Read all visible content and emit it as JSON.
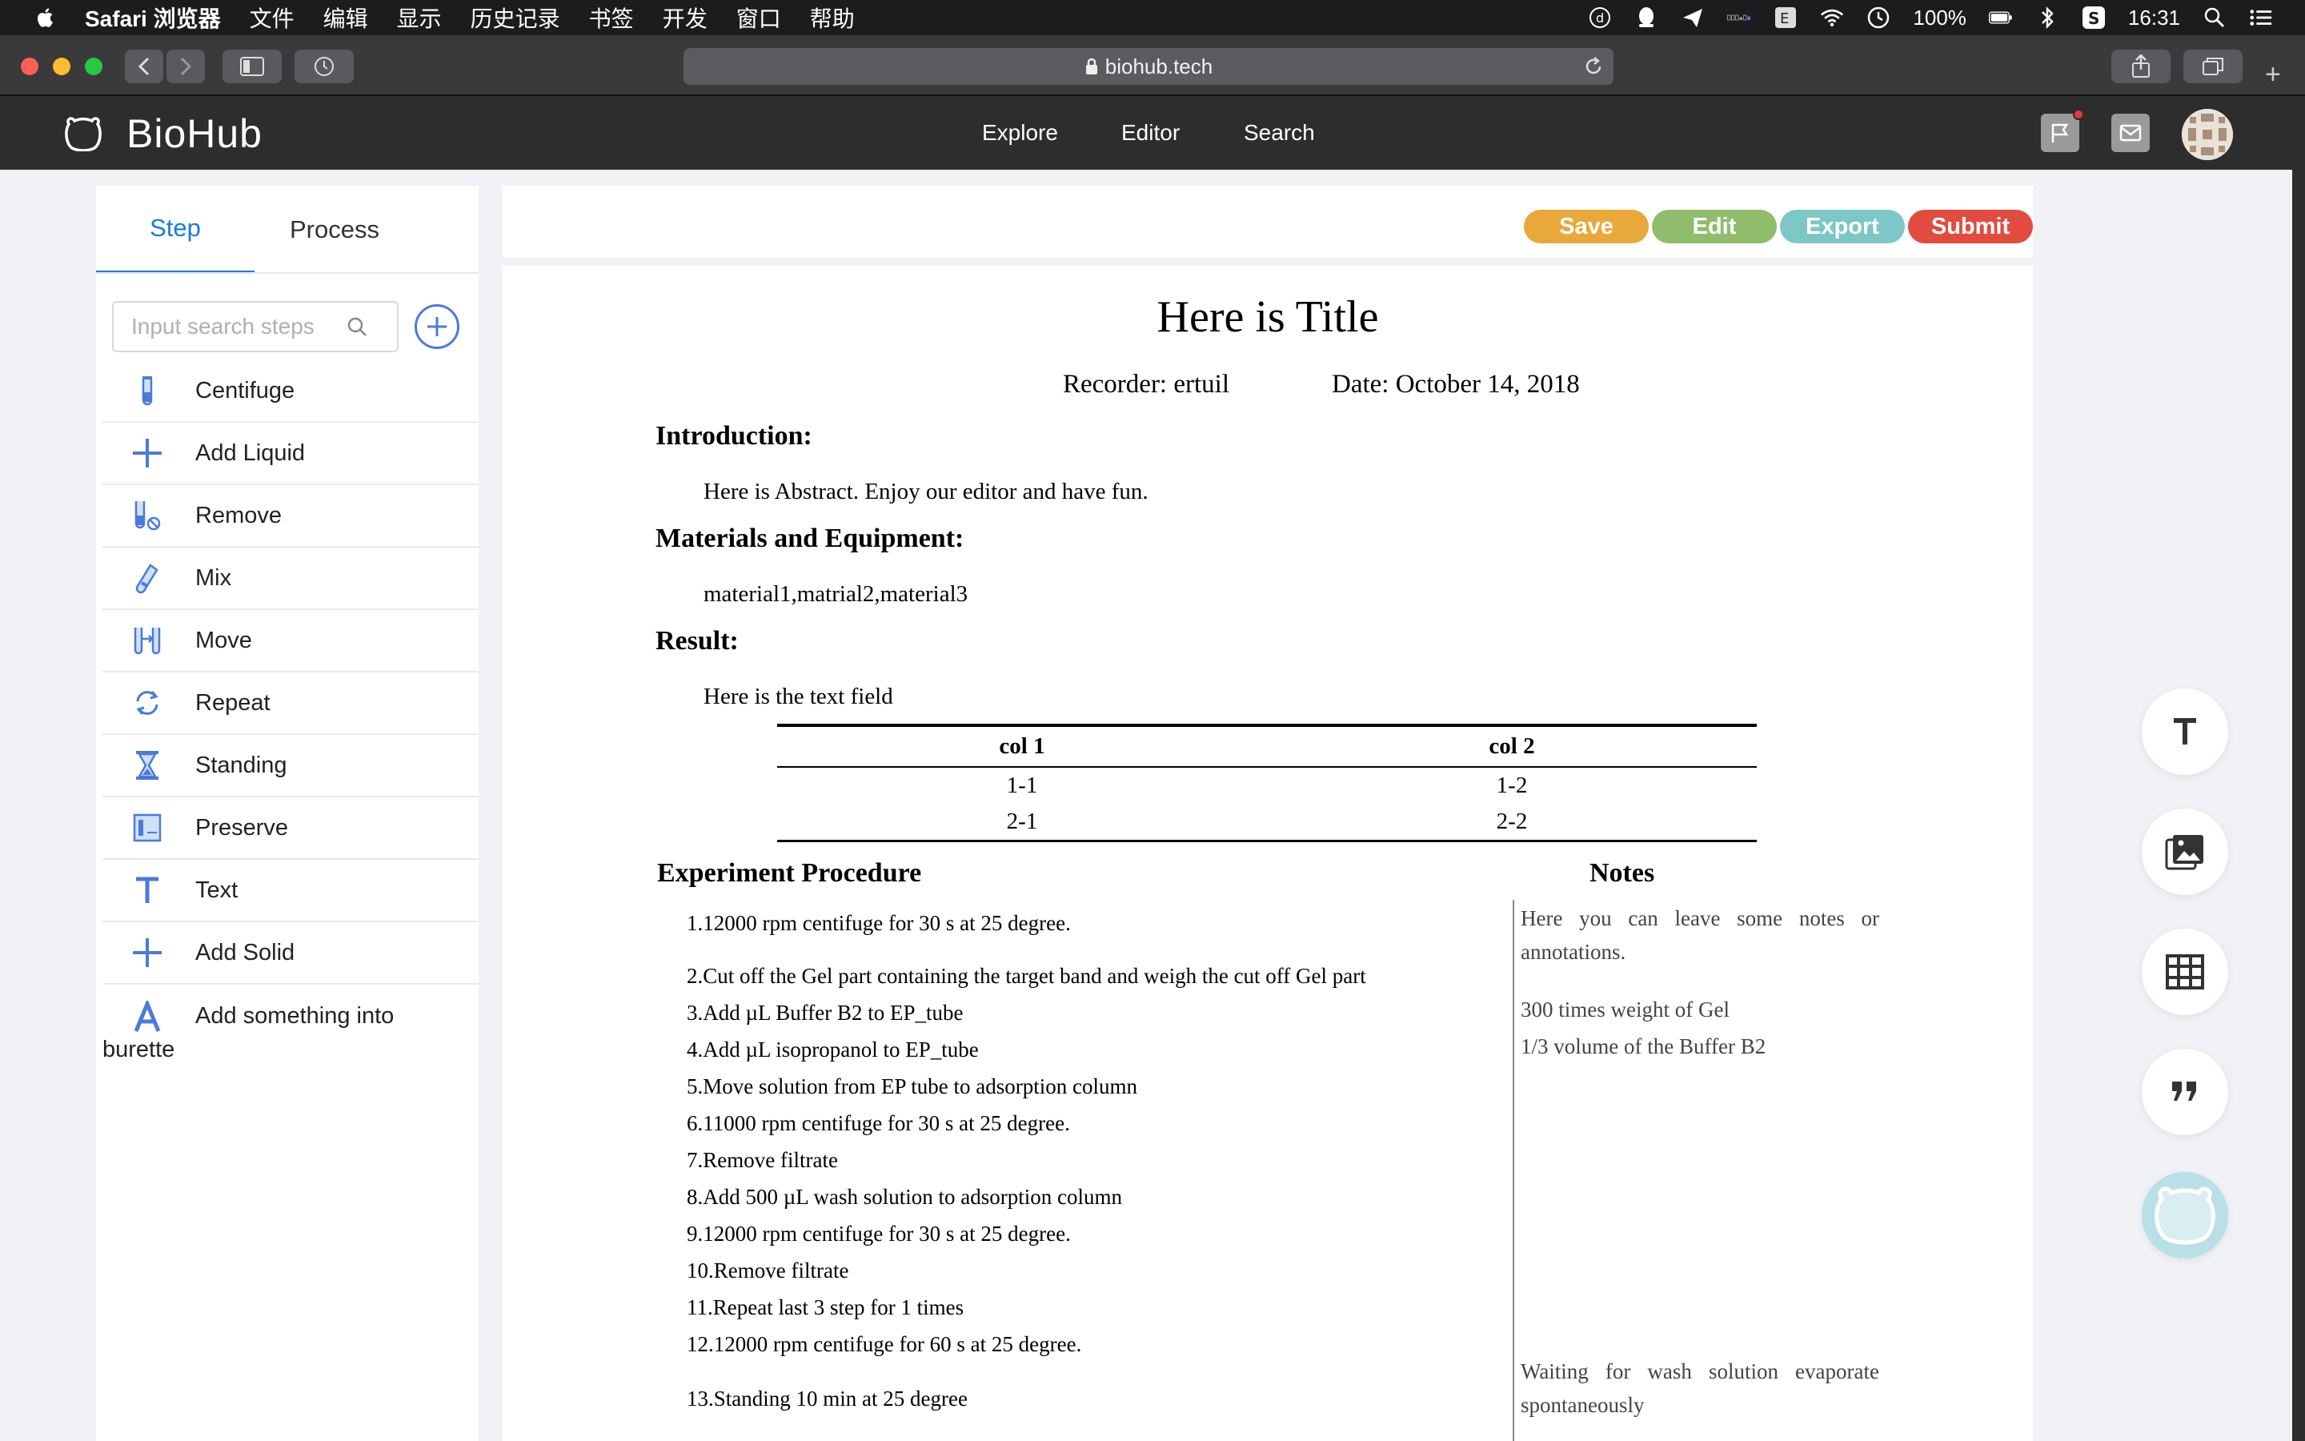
{
  "menubar": {
    "app_name": "Safari 浏览器",
    "items": [
      "文件",
      "编辑",
      "显示",
      "历史记录",
      "书签",
      "开发",
      "窗口",
      "帮助"
    ],
    "battery": "100%",
    "time": "16:31"
  },
  "browser": {
    "url": "biohub.tech"
  },
  "header": {
    "brand": "BioHub",
    "nav": [
      "Explore",
      "Editor",
      "Search"
    ]
  },
  "sidebar": {
    "tabs": [
      "Step",
      "Process"
    ],
    "search_placeholder": "Input search steps",
    "steps": [
      {
        "label": "Centifuge",
        "icon": "tube-icon"
      },
      {
        "label": "Add Liquid",
        "icon": "plus-icon"
      },
      {
        "label": "Remove",
        "icon": "remove-tube-icon"
      },
      {
        "label": "Mix",
        "icon": "mix-icon"
      },
      {
        "label": "Move",
        "icon": "move-icon"
      },
      {
        "label": "Repeat",
        "icon": "repeat-icon"
      },
      {
        "label": "Standing",
        "icon": "hourglass-icon"
      },
      {
        "label": "Preserve",
        "icon": "preserve-icon"
      },
      {
        "label": "Text",
        "icon": "text-icon"
      },
      {
        "label": "Add Solid",
        "icon": "plus-icon"
      },
      {
        "label": "Add something into burette",
        "icon": "letter-a-icon"
      }
    ]
  },
  "actions": {
    "save": "Save",
    "edit": "Edit",
    "export": "Export",
    "submit": "Submit",
    "colors": {
      "save": "#e8a93a",
      "edit": "#8fbd6c",
      "export": "#7dc7c6",
      "submit": "#e24b3f"
    }
  },
  "document": {
    "title": "Here is Title",
    "recorder": "Recorder: ertuil",
    "date": "Date: October 14, 2018",
    "intro_heading": "Introduction:",
    "intro_text": "Here is Abstract. Enjoy our editor and have fun.",
    "materials_heading": "Materials and Equipment:",
    "materials_text": "material1,matrial2,material3",
    "result_heading": "Result:",
    "result_text": "Here is the text field",
    "table": {
      "headers": [
        "col 1",
        "col 2"
      ],
      "rows": [
        [
          "1-1",
          "1-2"
        ],
        [
          "2-1",
          "2-2"
        ]
      ]
    },
    "procedure_heading": "Experiment Procedure",
    "notes_heading": "Notes",
    "steps": [
      "1.12000 rpm centifuge for 30 s at 25 degree.",
      "2.Cut off the Gel part containing the target band and weigh the cut off Gel part",
      "3.Add µL Buffer B2 to EP_tube",
      "4.Add µL isopropanol to EP_tube",
      "5.Move solution from EP tube to adsorption column",
      "6.11000 rpm centifuge for 30 s at 25 degree.",
      "7.Remove filtrate",
      "8.Add 500 µL wash solution to adsorption column",
      "9.12000 rpm centifuge for 30 s at 25 degree.",
      "10.Remove filtrate",
      "11.Repeat last 3 step for 1 times",
      "12.12000 rpm centifuge for 60 s at 25 degree.",
      "13.Standing 10 min at 25 degree"
    ],
    "notes": [
      "Here you can leave some notes or annotations.",
      "300 times weight of Gel",
      "1/3 volume of the Buffer B2",
      "Waiting for wash solution evaporate spontaneously"
    ]
  },
  "tools": [
    "text-tool-icon",
    "image-tool-icon",
    "table-tool-icon",
    "quote-tool-icon",
    "bear-assistant-icon"
  ]
}
